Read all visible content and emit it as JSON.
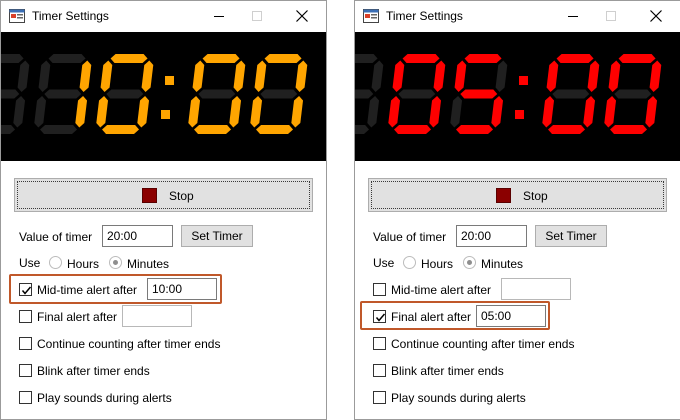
{
  "colors": {
    "orange": "#ffa500",
    "red": "#ff0000",
    "stop_square": "#8b0000",
    "highlight": "#c0582a"
  },
  "windows": [
    {
      "title": "Timer Settings",
      "display": {
        "text": "10:00",
        "color": "#ffa500"
      },
      "stop_label": "Stop",
      "value_label": "Value of timer",
      "value": "20:00",
      "set_timer_label": "Set Timer",
      "use_label": "Use",
      "unit_hours": "Hours",
      "unit_minutes": "Minutes",
      "selected_unit": "Minutes",
      "mid_alert_label": "Mid-time alert after",
      "mid_alert_checked": true,
      "mid_alert_value": "10:00",
      "final_alert_label": "Final alert after",
      "final_alert_checked": false,
      "final_alert_value": "",
      "continue_label": "Continue counting after timer ends",
      "continue_checked": false,
      "blink_label": "Blink after timer ends",
      "blink_checked": false,
      "sounds_label": "Play sounds during alerts",
      "sounds_checked": false
    },
    {
      "title": "Timer Settings",
      "display": {
        "text": "05:00",
        "color": "#ff0000"
      },
      "stop_label": "Stop",
      "value_label": "Value of timer",
      "value": "20:00",
      "set_timer_label": "Set Timer",
      "use_label": "Use",
      "unit_hours": "Hours",
      "unit_minutes": "Minutes",
      "selected_unit": "Minutes",
      "mid_alert_label": "Mid-time alert after",
      "mid_alert_checked": false,
      "mid_alert_value": "",
      "final_alert_label": "Final alert after",
      "final_alert_checked": true,
      "final_alert_value": "05:00",
      "continue_label": "Continue counting after timer ends",
      "continue_checked": false,
      "blink_label": "Blink after timer ends",
      "blink_checked": false,
      "sounds_label": "Play sounds during alerts",
      "sounds_checked": false
    }
  ]
}
